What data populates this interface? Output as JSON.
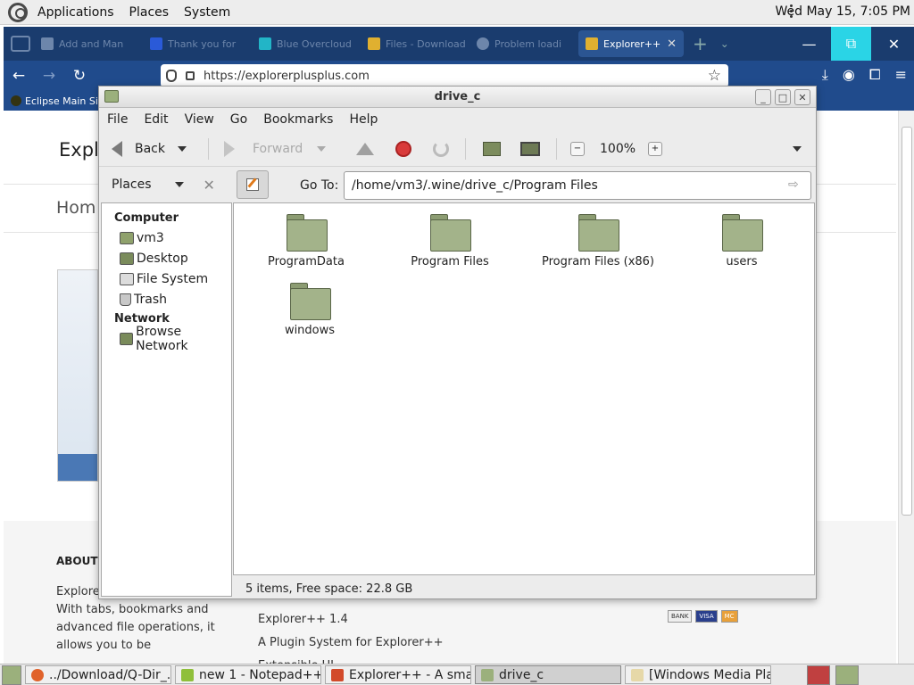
{
  "top_panel": {
    "menus": [
      "Applications",
      "Places",
      "System"
    ],
    "clock": "Wed May 15,  7:05 PM"
  },
  "firefox": {
    "tabs": [
      {
        "label": "Add and Man",
        "color": "#6d86ab"
      },
      {
        "label": "Thank you for",
        "color": "#2a5ad8"
      },
      {
        "label": "Blue Overcloud",
        "color": "#22b5c7"
      },
      {
        "label": "Files - Download",
        "color": "#e0b030"
      },
      {
        "label": "Problem loadi",
        "color": "#6d86ab"
      },
      {
        "label": "Explorer++",
        "color": "#e0b030",
        "active": true
      }
    ],
    "url": "https://explorerplusplus.com",
    "bookmark": "Eclipse Main Site"
  },
  "webpage": {
    "title": "Expl",
    "home": "Hom",
    "about_heading": "ABOUT",
    "about_text": "Explore manager for Windows. With tabs, bookmarks and advanced file operations, it allows you to be",
    "links": [
      "Explorer++ 1.4",
      "A Plugin System for Explorer++",
      "Extensible UI"
    ],
    "payment": [
      "BANK",
      "VISA",
      "MC"
    ]
  },
  "file_manager": {
    "window_title": "drive_c",
    "menu": [
      "File",
      "Edit",
      "View",
      "Go",
      "Bookmarks",
      "Help"
    ],
    "toolbar": {
      "back": "Back",
      "forward": "Forward",
      "zoom": "100%"
    },
    "places_label": "Places",
    "goto_label": "Go To:",
    "path": "/home/vm3/.wine/drive_c/Program Files",
    "sidebar": {
      "computer_header": "Computer",
      "computer_items": [
        "vm3",
        "Desktop",
        "File System",
        "Trash"
      ],
      "network_header": "Network",
      "network_items": [
        "Browse Network"
      ]
    },
    "items": [
      "ProgramData",
      "Program Files",
      "Program Files (x86)",
      "users",
      "windows"
    ],
    "status": "5 items, Free space: 22.8 GB"
  },
  "taskbar": {
    "tasks": [
      {
        "label": "../Download/Q-Dir_...",
        "color": "#e0622a"
      },
      {
        "label": "new 1 - Notepad++ ...",
        "color": "#8fbf3a"
      },
      {
        "label": "Explorer++ - A smal...",
        "color": "#d24a2a"
      },
      {
        "label": "drive_c",
        "color": "#9bb07c",
        "active": true
      },
      {
        "label": "[Windows Media Pla...",
        "color": "#e6d8a8"
      }
    ]
  }
}
